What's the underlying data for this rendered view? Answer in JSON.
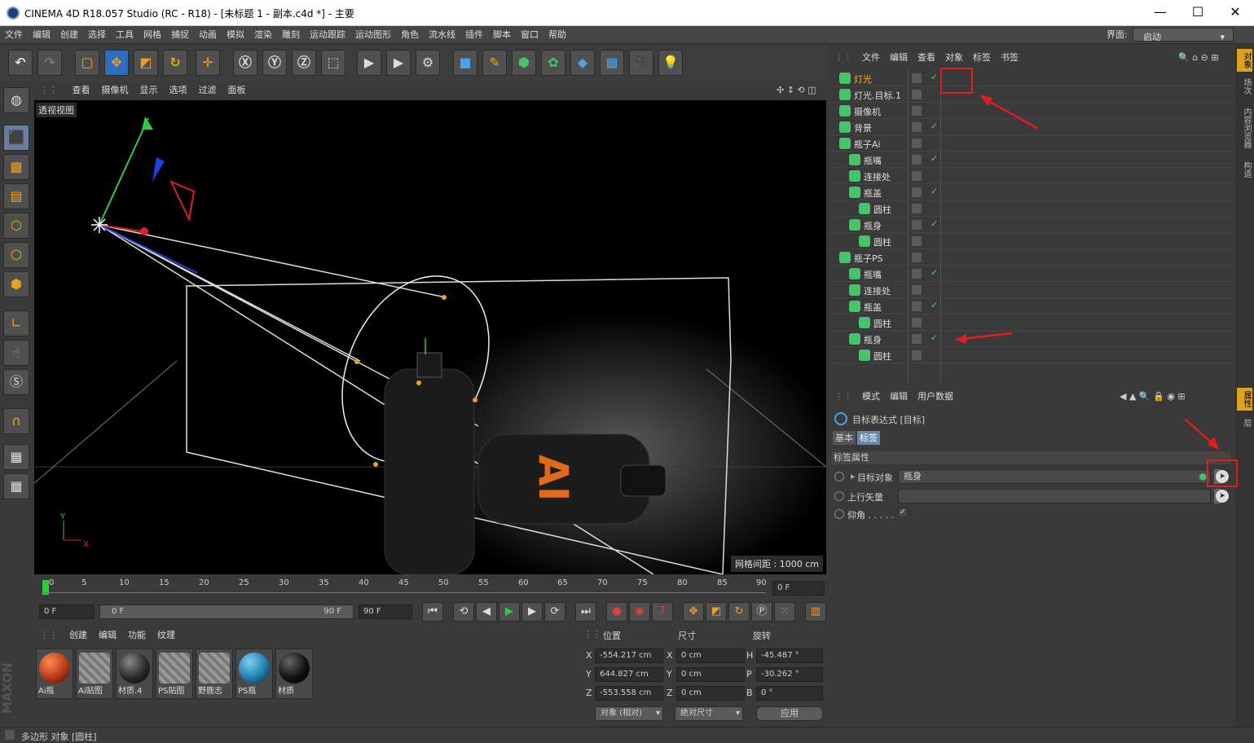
{
  "window": {
    "title": "CINEMA 4D R18.057 Studio (RC - R18) - [未标题 1 - 副本.c4d *] - 主要"
  },
  "menu": [
    "文件",
    "编辑",
    "创建",
    "选择",
    "工具",
    "网格",
    "捕捉",
    "动画",
    "模拟",
    "渲染",
    "雕刻",
    "运动跟踪",
    "运动图形",
    "角色",
    "流水线",
    "插件",
    "脚本",
    "窗口",
    "帮助"
  ],
  "layout": {
    "label": "界面:",
    "value": "启动"
  },
  "viewport": {
    "menu": [
      "查看",
      "摄像机",
      "显示",
      "选项",
      "过滤",
      "面板"
    ],
    "label": "透视视图",
    "grid_info": "网格间距 : 1000 cm",
    "axis_y": "Y",
    "axis_x": "X"
  },
  "timeline": {
    "ticks": [
      "0",
      "5",
      "10",
      "15",
      "20",
      "25",
      "30",
      "35",
      "40",
      "45",
      "50",
      "55",
      "60",
      "65",
      "70",
      "75",
      "80",
      "85",
      "90"
    ],
    "current_frame": "0 F",
    "start": "0 F",
    "range_start": "0 F",
    "range_end": "90 F",
    "end": "90 F"
  },
  "materials": {
    "menu": [
      "创建",
      "编辑",
      "功能",
      "纹理"
    ],
    "items": [
      {
        "name": "Ai瓶",
        "color": "#b33a1a"
      },
      {
        "name": "Ai贴图",
        "color": "#888888"
      },
      {
        "name": "材质.4",
        "color": "#2a2a2a"
      },
      {
        "name": "PS贴图",
        "color": "#888888"
      },
      {
        "name": "野鹿志",
        "color": "#888888"
      },
      {
        "name": "PS瓶",
        "color": "#1f7fb0"
      },
      {
        "name": "材质",
        "color": "#111111"
      }
    ]
  },
  "coords": {
    "headers": [
      "位置",
      "尺寸",
      "旋转"
    ],
    "rows": [
      {
        "axis": "X",
        "pos": "-554.217 cm",
        "size_axis": "X",
        "size": "0 cm",
        "rot_axis": "H",
        "rot": "-45.487 °"
      },
      {
        "axis": "Y",
        "pos": "644.827 cm",
        "size_axis": "Y",
        "size": "0 cm",
        "rot_axis": "P",
        "rot": "-30.262 °"
      },
      {
        "axis": "Z",
        "pos": "-553.558 cm",
        "size_axis": "Z",
        "size": "0 cm",
        "rot_axis": "B",
        "rot": "0 °"
      }
    ],
    "mode1": "对象 (相对)",
    "mode2": "绝对尺寸",
    "apply": "应用"
  },
  "status": "多边形 对象 [圆柱]",
  "object_manager": {
    "menu": [
      "文件",
      "编辑",
      "查看",
      "对象",
      "标签",
      "书签"
    ],
    "rows": [
      {
        "name": "灯光",
        "indent": 0,
        "check": "✓",
        "highlight": true
      },
      {
        "name": "灯光.目标.1",
        "indent": 0,
        "check": ""
      },
      {
        "name": "摄像机",
        "indent": 0,
        "check": ""
      },
      {
        "name": "背景",
        "indent": 0,
        "check": "✓"
      },
      {
        "name": "瓶子Ai",
        "indent": 0,
        "check": ""
      },
      {
        "name": "瓶嘴",
        "indent": 1,
        "check": "✓"
      },
      {
        "name": "连接处",
        "indent": 1,
        "check": ""
      },
      {
        "name": "瓶盖",
        "indent": 1,
        "check": "✓"
      },
      {
        "name": "圆柱",
        "indent": 2,
        "check": ""
      },
      {
        "name": "瓶身",
        "indent": 1,
        "check": "✓"
      },
      {
        "name": "圆柱",
        "indent": 2,
        "check": ""
      },
      {
        "name": "瓶子PS",
        "indent": 0,
        "check": ""
      },
      {
        "name": "瓶嘴",
        "indent": 1,
        "check": "✓"
      },
      {
        "name": "连接处",
        "indent": 1,
        "check": ""
      },
      {
        "name": "瓶盖",
        "indent": 1,
        "check": "✓"
      },
      {
        "name": "圆柱",
        "indent": 2,
        "check": ""
      },
      {
        "name": "瓶身",
        "indent": 1,
        "check": "✓"
      },
      {
        "name": "圆柱",
        "indent": 2,
        "check": ""
      }
    ]
  },
  "attributes": {
    "menu": [
      "模式",
      "编辑",
      "用户数据"
    ],
    "title": "目标表达式 [目标]",
    "tabs": [
      "基本",
      "标签"
    ],
    "section": "标签属性",
    "target_label": "目标对象",
    "target_value": "瓶身",
    "up_label": "上行矢量",
    "pitch_label": "仰角 . . . . .",
    "pitch_check": "✓"
  },
  "right_tabs": [
    "对象",
    "场次",
    "内容浏览器",
    "构造",
    "属性",
    "层"
  ]
}
